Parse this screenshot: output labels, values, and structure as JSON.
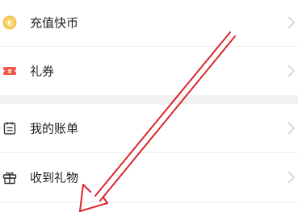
{
  "menu": {
    "items": [
      {
        "label": "充值快币",
        "icon": "coin-icon"
      },
      {
        "label": "礼券",
        "icon": "coupon-icon"
      },
      {
        "label": "我的账单",
        "icon": "bill-icon"
      },
      {
        "label": "收到礼物",
        "icon": "gift-icon"
      }
    ]
  },
  "colors": {
    "coin": "#f2c14e",
    "coupon": "#f0584a",
    "icon_dark": "#333333",
    "chevron": "#c8c8c8",
    "annotation_arrow": "#d9262b",
    "section_gap": "#f2f2f2"
  },
  "annotation": {
    "type": "arrow",
    "direction": "down-left"
  }
}
